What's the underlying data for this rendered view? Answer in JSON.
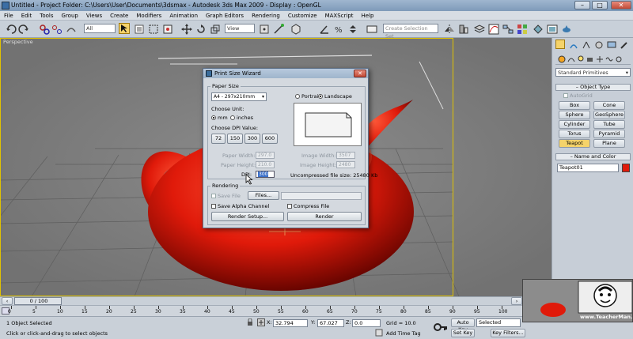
{
  "window": {
    "title": "Untitled    - Project Folder: C:\\Users\\User\\Documents\\3dsmax    - Autodesk 3ds Max  2009     - Display : OpenGL",
    "min": "–",
    "max": "□",
    "close": "✕"
  },
  "menu": [
    "File",
    "Edit",
    "Tools",
    "Group",
    "Views",
    "Create",
    "Modifiers",
    "Animation",
    "Graph Editors",
    "Rendering",
    "Customize",
    "MAXScript",
    "Help"
  ],
  "toolbar": {
    "selection_filter": "All",
    "ref_coord": "View",
    "named_selection_placeholder": "Create Selection Set"
  },
  "viewport": {
    "label": "Perspective"
  },
  "dialog": {
    "title": "Print Size Wizard",
    "close": "✕",
    "paper_size_group": "Paper Size",
    "paper_size_value": "A4 - 297x210mm",
    "portrait": "Portrait",
    "landscape": "Landscape",
    "choose_unit": "Choose Unit:",
    "unit_mm": "mm",
    "unit_inches": "inches",
    "choose_dpi": "Choose DPI Value:",
    "dpi_buttons": [
      "72",
      "150",
      "300",
      "600"
    ],
    "paper_width_label": "Paper Width:",
    "paper_width_value": "297.0",
    "paper_height_label": "Paper Height:",
    "paper_height_value": "210.0",
    "dpi_label": "DPI:",
    "dpi_value": "300",
    "image_width_label": "Image Width:",
    "image_width_value": "3507",
    "image_height_label": "Image Height:",
    "image_height_value": "2480",
    "uncompressed": "Uncompressed file size: 25480 Kb",
    "rendering_group": "Rendering",
    "save_file": "Save File",
    "files_button": "Files...",
    "save_alpha": "Save Alpha Channel",
    "compress_file": "Compress File",
    "render_setup_button": "Render Setup...",
    "render_button": "Render"
  },
  "command_panel": {
    "category": "Standard Primitives",
    "object_type_title": "Object Type",
    "autogrid": "AutoGrid",
    "buttons": [
      "Box",
      "Cone",
      "Sphere",
      "GeoSphere",
      "Cylinder",
      "Tube",
      "Torus",
      "Pyramid",
      "Teapot",
      "Plane"
    ],
    "name_color_title": "Name and Color",
    "object_name": "Teapot01",
    "object_color": "#e01a0a"
  },
  "timeline": {
    "slider_label": "0 / 100",
    "ticks": [
      "0",
      "5",
      "10",
      "15",
      "20",
      "25",
      "30",
      "35",
      "40",
      "45",
      "50",
      "55",
      "60",
      "65",
      "70",
      "75",
      "80",
      "85",
      "90",
      "95",
      "100"
    ]
  },
  "status": {
    "selection": "1 Object Selected",
    "prompt": "Click or click-and-drag to select objects",
    "x_label": "X:",
    "x_value": "32.794",
    "y_label": "Y:",
    "y_value": "67.027",
    "z_label": "Z:",
    "z_value": "0.0",
    "grid": "Grid = 10.0",
    "add_time_tag": "Add Time Tag",
    "auto_key": "Auto Key",
    "set_key": "Set Key",
    "key_mode": "Selected",
    "key_filters": "Key Filters..."
  },
  "watermark": {
    "text": "www.TeacherMan.ir"
  },
  "colors": {
    "teapot": "#e01a0a",
    "viewport_bg": "#7d7d7d",
    "active_border": "#e0c200"
  }
}
